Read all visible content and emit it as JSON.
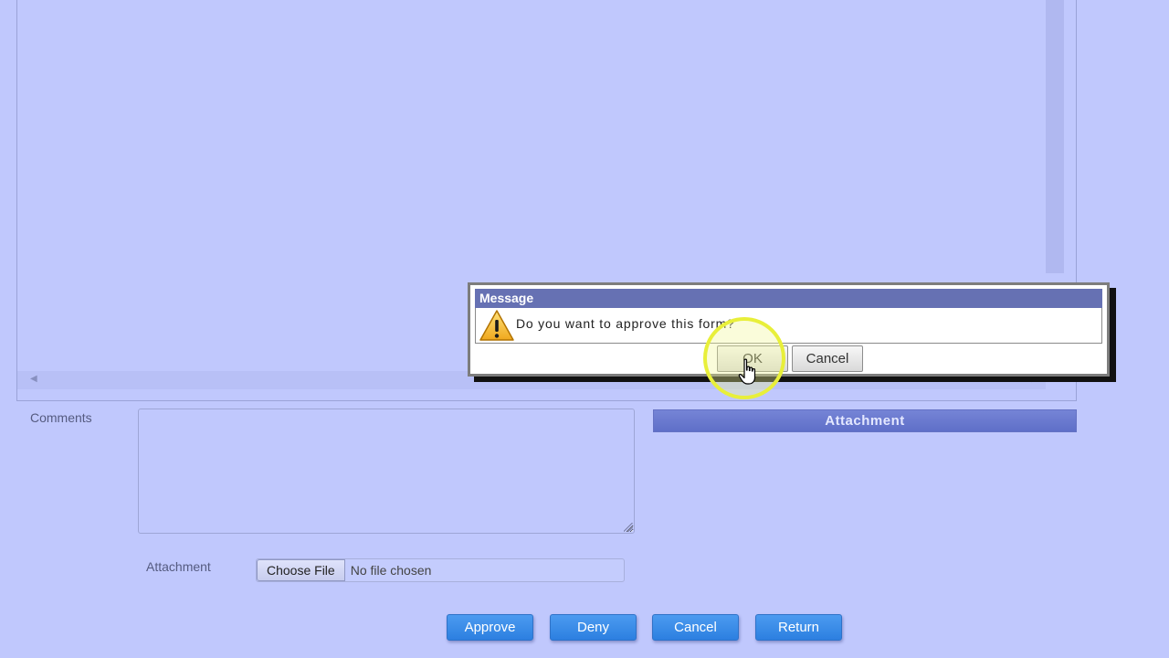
{
  "form": {
    "comments_label": "Comments",
    "comments_value": "",
    "attachment_header": "Attachment",
    "attachment_label": "Attachment",
    "choose_file_label": "Choose File",
    "no_file_text": "No file chosen"
  },
  "actions": {
    "approve": "Approve",
    "deny": "Deny",
    "cancel": "Cancel",
    "return": "Return"
  },
  "dialog": {
    "title": "Message",
    "message": "Do you want to approve this form?",
    "ok_label": "OK",
    "cancel_label": "Cancel",
    "icon": "warning-icon"
  },
  "colors": {
    "background": "#c0c8fd",
    "button_blue": "#3a8ae8",
    "dialog_title": "#6671b3",
    "highlight": "#e8ef3a"
  }
}
